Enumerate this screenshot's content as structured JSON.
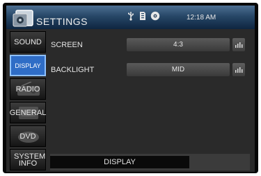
{
  "header": {
    "title": "SETTINGS",
    "clock": "12:18 AM",
    "status_icons": [
      "usb-icon",
      "sd-card-icon",
      "disc-icon"
    ]
  },
  "sidebar": {
    "items": [
      {
        "label": "SOUND",
        "active": false
      },
      {
        "label": "DISPLAY",
        "active": true
      },
      {
        "label": "RADIO",
        "active": false
      },
      {
        "label": "GENERAL",
        "active": false
      },
      {
        "label": "DVD",
        "active": false
      },
      {
        "label": "SYSTEM INFO",
        "active": false
      }
    ]
  },
  "settings": [
    {
      "label": "SCREEN",
      "value": "4:3"
    },
    {
      "label": "BACKLIGHT",
      "value": "MID"
    }
  ],
  "footer": {
    "label": "DISPLAY"
  },
  "colors": {
    "header": "#274767",
    "active_tab": "#2f6dc6",
    "background": "#2a2a2a"
  }
}
